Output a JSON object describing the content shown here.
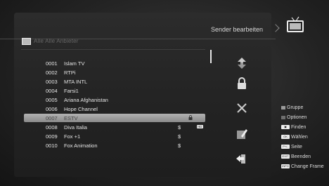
{
  "header": {
    "title": "Sender bearbeiten"
  },
  "list": {
    "title": "Alle Alle Anbieter",
    "rows": [
      {
        "num": "0001",
        "name": "Islam TV",
        "symbol": "",
        "tag": ""
      },
      {
        "num": "0002",
        "name": "RTPi",
        "symbol": "",
        "tag": ""
      },
      {
        "num": "0003",
        "name": "MTA INTL",
        "symbol": "",
        "tag": ""
      },
      {
        "num": "0004",
        "name": "Farsi1",
        "symbol": "",
        "tag": ""
      },
      {
        "num": "0005",
        "name": "Ariana Afghanistan",
        "symbol": "",
        "tag": ""
      },
      {
        "num": "0006",
        "name": "Hope Channel",
        "symbol": "",
        "tag": ""
      },
      {
        "num": "0007",
        "name": "ESTV",
        "symbol": "",
        "tag": "",
        "locked": true
      },
      {
        "num": "0008",
        "name": "Diva Italia",
        "symbol": "$",
        "tag": "HD"
      },
      {
        "num": "0009",
        "name": "Fox +1",
        "symbol": "$",
        "tag": ""
      },
      {
        "num": "0010",
        "name": "Fox Animation",
        "symbol": "$",
        "tag": ""
      }
    ],
    "selected_index": 6
  },
  "actions": [
    "move-icon",
    "lock-icon",
    "delete-icon",
    "rename-icon",
    "exit-icon"
  ],
  "legend": {
    "gruppe": "Gruppe",
    "optionen": "Optionen",
    "finden": "Finden",
    "waehlen": "Wählen",
    "seite": "Seite",
    "beenden": "Beenden",
    "change_frame": "Change Frame",
    "key_ok": "OK",
    "key_pg": "P+/-",
    "key_exit": "EXIT",
    "key_info": "INFO",
    "colors": {
      "gruppe": "#9a9a9a",
      "optionen": "#6f6f6f"
    }
  }
}
